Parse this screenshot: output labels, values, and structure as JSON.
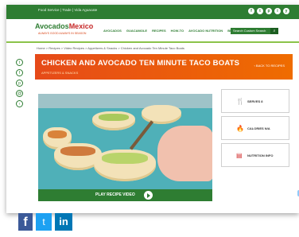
{
  "topbar": {
    "links": "Food Service  |  Trade  |  Vida Aguacate",
    "social_icons": [
      "f",
      "t",
      "p",
      "i",
      "y"
    ]
  },
  "header": {
    "logo_left": "Avocados",
    "logo_right": "Mexico",
    "logo_sub": "ALWAYS GOOD ALWAYS IN SEASON",
    "nav": [
      "AVOCADOS",
      "GUACAMOLE",
      "RECIPES",
      "HOW-TO",
      "AVOCADO NUTRITION",
      "BLOG"
    ],
    "search_placeholder": "Search Custom Search"
  },
  "breadcrumb": "Home  >  Recipes  >  Video Recipes  >  Appetizers & Snacks  >  Chicken and Avocado Ten Minute Taco Boats",
  "banner": {
    "title": "CHICKEN AND AVOCADO TEN MINUTE TACO BOATS",
    "category": "APPETIZERS & SNACKS",
    "back_label": "‹ BACK TO RECIPES"
  },
  "video": {
    "play_label": "PLAY RECIPE VIDEO"
  },
  "info_cards": [
    {
      "icon": "fork-knife-icon",
      "glyph": "🍴",
      "label": "SERVES 8"
    },
    {
      "icon": "flame-icon",
      "glyph": "🔥",
      "label": "CALORIES N/A"
    },
    {
      "icon": "nutrition-icon",
      "glyph": "▤",
      "label": "NUTRITION INFO"
    }
  ],
  "footer_social": {
    "facebook": "f",
    "twitter": "t",
    "linkedin": "in"
  },
  "colors": {
    "brand_green": "#2e7d32",
    "banner_orange": "#e64a19"
  }
}
